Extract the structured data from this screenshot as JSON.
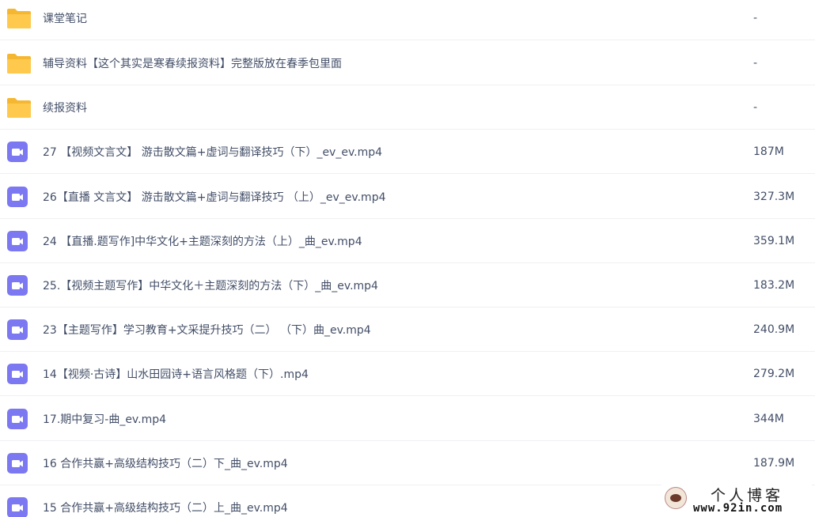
{
  "files": [
    {
      "type": "folder",
      "name": "课堂笔记",
      "size": "-"
    },
    {
      "type": "folder",
      "name": "辅导资料【这个其实是寒春续报资料】完整版放在春季包里面",
      "size": "-"
    },
    {
      "type": "folder",
      "name": "续报资料",
      "size": "-"
    },
    {
      "type": "video",
      "name": "27 【视频文言文】 游击散文篇+虚词与翻译技巧（下）_ev_ev.mp4",
      "size": "187M"
    },
    {
      "type": "video",
      "name": "26【直播 文言文】 游击散文篇+虚词与翻译技巧 （上）_ev_ev.mp4",
      "size": "327.3M"
    },
    {
      "type": "video",
      "name": "24 【直播.题写作]中华文化+主题深刻的方法（上）_曲_ev.mp4",
      "size": "359.1M"
    },
    {
      "type": "video",
      "name": "25.【视频主题写作】中华文化＋主题深刻的方法（下）_曲_ev.mp4",
      "size": "183.2M"
    },
    {
      "type": "video",
      "name": "23【主题写作】学习教育+文采提升技巧（二） （下）曲_ev.mp4",
      "size": "240.9M"
    },
    {
      "type": "video",
      "name": "14【视频·古诗】山水田园诗+语言风格题（下）.mp4",
      "size": "279.2M"
    },
    {
      "type": "video",
      "name": "17.期中复习-曲_ev.mp4",
      "size": "344M"
    },
    {
      "type": "video",
      "name": "16 合作共赢+高级结构技巧（二）下_曲_ev.mp4",
      "size": "187.9M"
    },
    {
      "type": "video",
      "name": "15 合作共赢+高级结构技巧（二）上_曲_ev.mp4",
      "size": ""
    }
  ],
  "icons": {
    "folder": "folder-icon",
    "video": "video-file-icon"
  },
  "colors": {
    "folder": "#ffc94d",
    "folder_tab": "#f5b731",
    "video": "#7b78f2",
    "text": "#424e67",
    "divider": "#eef0f4"
  },
  "watermark": {
    "title": "个人博客",
    "domain": "www.92in.com"
  }
}
